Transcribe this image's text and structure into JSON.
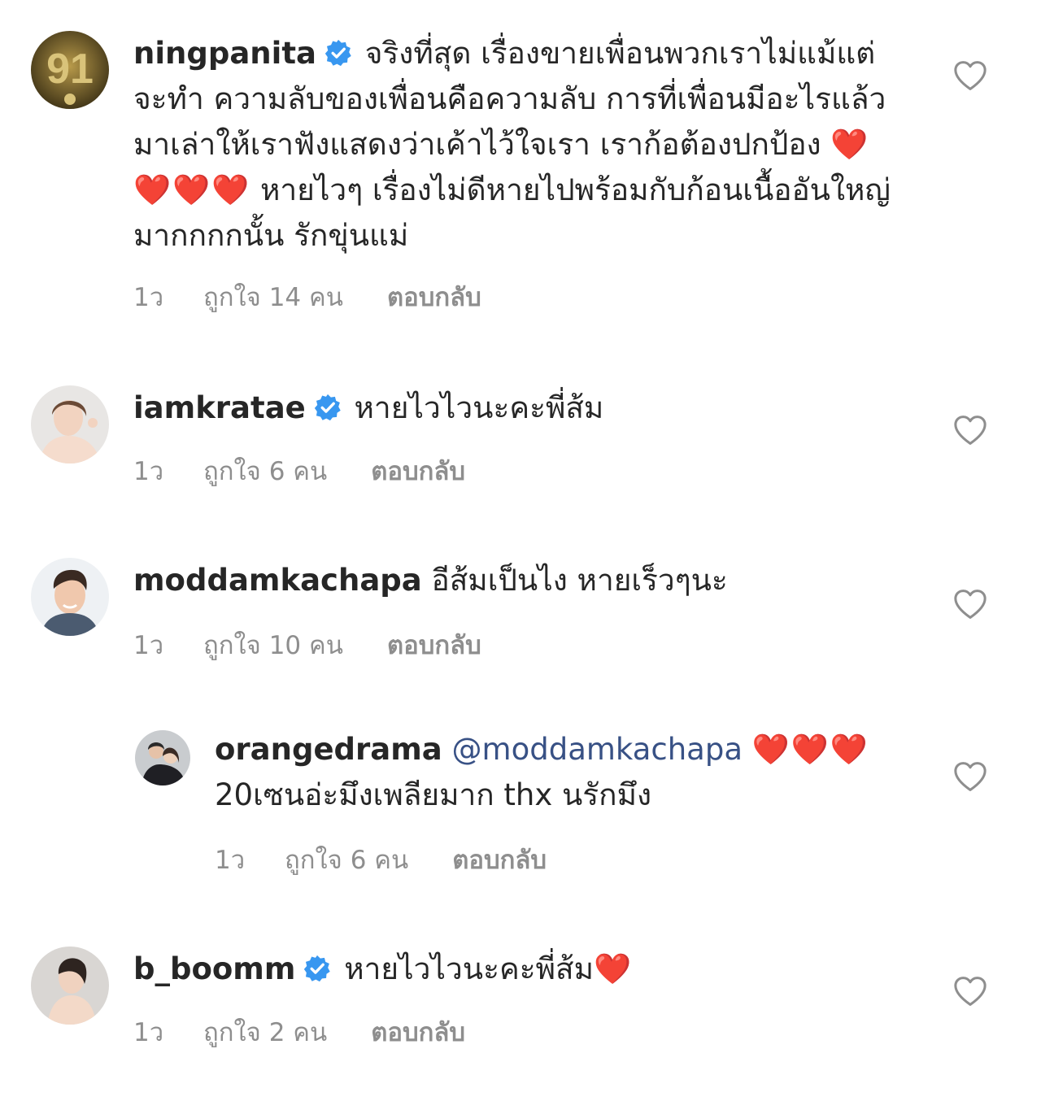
{
  "comments": [
    {
      "username": "ningpanita",
      "verified": true,
      "text": "จริงที่สุด เรื่องขายเพื่อนพวกเราไม่แม้แต่จะทำ ความลับของเพื่อนคือความลับ การที่เพื่อนมีอะไรแล้วมาเล่าให้เราฟังแสดงว่าเค้าไว้ใจเรา เราก้อต้องปกป้อง",
      "hearts": "❤️❤️❤️❤️",
      "text2": " หายไวๆ เรื่องไม่ดีหายไปพร้อมกับก้อนเนื้ออันใหญ่มากกกกนั้น  รักขุ่นแม่",
      "avatar_label": "91",
      "time": "1ว",
      "likes": "ถูกใจ 14 คน",
      "reply": "ตอบกลับ"
    },
    {
      "username": "iamkratae",
      "verified": true,
      "text": "หายไวไวนะคะพี่ส้ม",
      "time": "1ว",
      "likes": "ถูกใจ 6 คน",
      "reply": "ตอบกลับ"
    },
    {
      "username": "moddamkachapa",
      "verified": false,
      "text": "อีส้มเป็นไง หายเร็วๆนะ",
      "time": "1ว",
      "likes": "ถูกใจ 10 คน",
      "reply": "ตอบกลับ"
    },
    {
      "username": "orangedrama",
      "verified": false,
      "mention": "@moddamkachapa",
      "hearts": "❤️❤️❤️",
      "text": "20เซนอ่ะมึงเพลียมาก thx นรักมึง",
      "time": "1ว",
      "likes": "ถูกใจ 6 คน",
      "reply": "ตอบกลับ"
    },
    {
      "username": "b_boomm",
      "verified": true,
      "text": "หายไวไวนะคะพี่ส้ม",
      "hearts": "❤️",
      "time": "1ว",
      "likes": "ถูกใจ 2 คน",
      "reply": "ตอบกลับ"
    }
  ],
  "colors": {
    "verified_blue": "#3897f0",
    "mention_blue": "#385185",
    "meta_gray": "#8e8e8e",
    "heart_red": "#e0242e"
  },
  "icons": {
    "like": "heart-outline-icon",
    "verified": "verified-badge-icon"
  }
}
